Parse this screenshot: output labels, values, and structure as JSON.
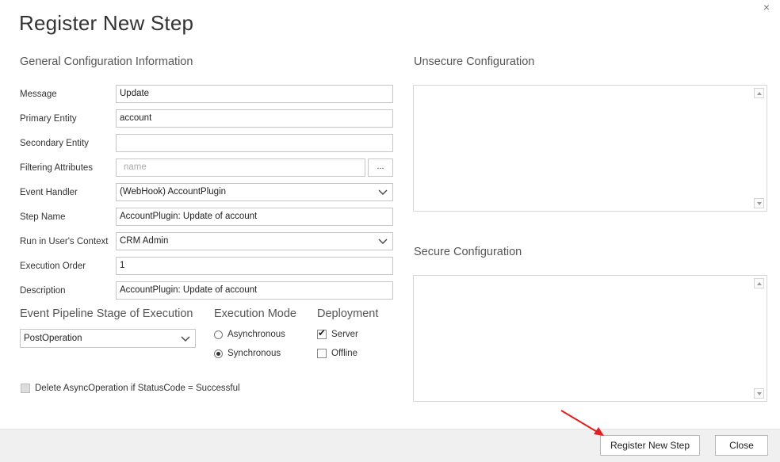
{
  "dialog": {
    "title": "Register New Step",
    "close_glyph": "×"
  },
  "general": {
    "heading": "General Configuration Information",
    "fields": [
      {
        "label": "Message",
        "value": "Update"
      },
      {
        "label": "Primary Entity",
        "value": "account"
      },
      {
        "label": "Secondary Entity",
        "value": ""
      },
      {
        "label": "Filtering Attributes",
        "placeholder": "name",
        "button": "..."
      },
      {
        "label": "Event Handler",
        "value": "(WebHook) AccountPlugin"
      },
      {
        "label": "Step Name",
        "value": "AccountPlugin: Update of account"
      },
      {
        "label": "Run in User's Context",
        "value": "CRM Admin"
      },
      {
        "label": "Execution Order",
        "value": "1"
      },
      {
        "label": "Description",
        "value": "AccountPlugin: Update of account"
      }
    ]
  },
  "pipeline": {
    "heading": "Event Pipeline Stage of Execution",
    "selected": "PostOperation"
  },
  "execution_mode": {
    "heading": "Execution Mode",
    "options": [
      {
        "label": "Asynchronous",
        "checked": false
      },
      {
        "label": "Synchronous",
        "checked": true
      }
    ]
  },
  "deployment": {
    "heading": "Deployment",
    "options": [
      {
        "label": "Server",
        "checked": true
      },
      {
        "label": "Offline",
        "checked": false
      }
    ]
  },
  "delete_async": {
    "label": "Delete AsyncOperation if StatusCode = Successful",
    "checked": false
  },
  "unsecure": {
    "heading": "Unsecure  Configuration",
    "value": ""
  },
  "secure": {
    "heading": "Secure  Configuration",
    "value": ""
  },
  "footer": {
    "register_label": "Register New Step",
    "close_label": "Close"
  },
  "colors": {
    "annotation_arrow": "#e02020",
    "footer_bg": "#f0f0f0"
  },
  "icons": [
    "close-icon",
    "chevron-down-icon",
    "scroll-up-icon",
    "scroll-down-icon",
    "annotation-arrow-icon"
  ]
}
